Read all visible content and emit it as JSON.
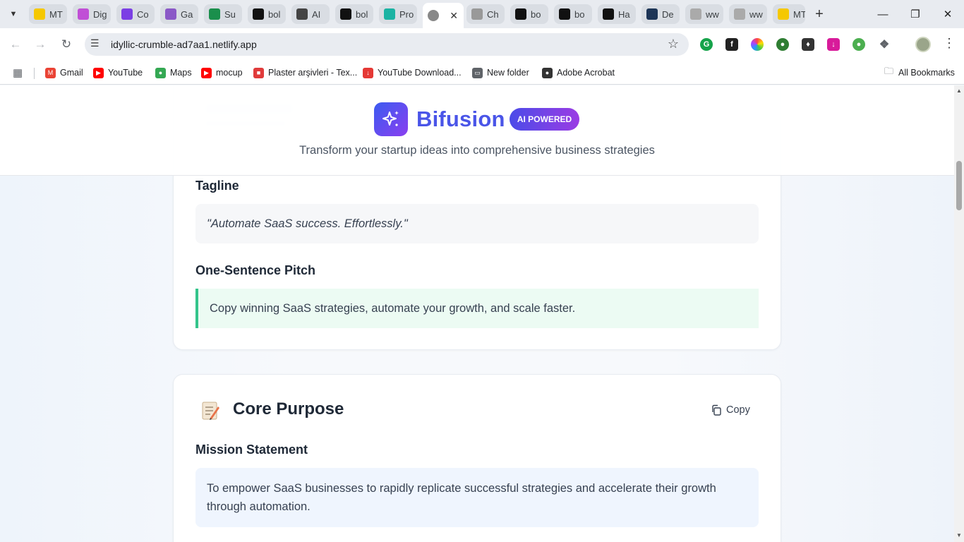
{
  "browser": {
    "tabs": [
      {
        "title": "MT",
        "favicon": "mtn-icon",
        "color": "#f5c800"
      },
      {
        "title": "Dig",
        "favicon": "grid-icon",
        "color": "#c04fd6"
      },
      {
        "title": "Co",
        "favicon": "arrow-icon",
        "color": "#7b3fe4"
      },
      {
        "title": "Ga",
        "favicon": "circle-icon",
        "color": "#8a58c7"
      },
      {
        "title": "Su",
        "favicon": "bolt-icon",
        "color": "#1a8f4c"
      },
      {
        "title": "bol",
        "favicon": "bolt-b-icon",
        "color": "#111111"
      },
      {
        "title": "AI",
        "favicon": "openai-icon",
        "color": "#444444"
      },
      {
        "title": "bol",
        "favicon": "bolt-b-icon",
        "color": "#111111"
      },
      {
        "title": "Pro",
        "favicon": "diamond-icon",
        "color": "#1bb3a3"
      },
      {
        "title": "",
        "favicon": "globe-icon",
        "color": "#888888",
        "active": true
      },
      {
        "title": "Ch",
        "favicon": "globe-icon",
        "color": "#999999"
      },
      {
        "title": "bo",
        "favicon": "bolt-b-icon",
        "color": "#111111"
      },
      {
        "title": "bo",
        "favicon": "bolt-b-icon",
        "color": "#111111"
      },
      {
        "title": "Ha",
        "favicon": "bolt-b-icon",
        "color": "#111111"
      },
      {
        "title": "De",
        "favicon": "d-icon",
        "color": "#1d3557"
      },
      {
        "title": "ww",
        "favicon": "globe-icon",
        "color": "#aaaaaa"
      },
      {
        "title": "ww",
        "favicon": "globe-icon",
        "color": "#aaaaaa"
      },
      {
        "title": "MT",
        "favicon": "mtn-icon",
        "color": "#f5c800"
      }
    ],
    "url": "idyllic-crumble-ad7aa1.netlify.app",
    "bookmarks": [
      {
        "label": "Gmail",
        "icon": "gmail-icon",
        "color": "#ea4335"
      },
      {
        "label": "YouTube",
        "icon": "youtube-icon",
        "color": "#ff0000"
      },
      {
        "label": "Maps",
        "icon": "maps-icon",
        "color": "#34a853"
      },
      {
        "label": "mocup",
        "icon": "youtube-icon",
        "color": "#ff0000"
      },
      {
        "label": "Plaster arşivleri - Tex...",
        "icon": "plaster-icon",
        "color": "#e03b3b"
      },
      {
        "label": "YouTube Download...",
        "icon": "download-icon",
        "color": "#e53935"
      },
      {
        "label": "New folder",
        "icon": "folder-icon",
        "color": "#5f6368"
      },
      {
        "label": "Adobe Acrobat",
        "icon": "acrobat-icon",
        "color": "#333333"
      }
    ],
    "all_bookmarks": "All Bookmarks"
  },
  "app": {
    "brand": "Bifusion",
    "badge": "AI POWERED",
    "subtitle": "Transform your startup ideas into comprehensive business strategies",
    "accent": "#4a55e8"
  },
  "branding_card": {
    "tagline_heading": "Tagline",
    "tagline": "\"Automate SaaS success. Effortlessly.\"",
    "pitch_heading": "One-Sentence Pitch",
    "pitch": "Copy winning SaaS strategies, automate your growth, and scale faster."
  },
  "core_purpose": {
    "title": "Core Purpose",
    "icon": "memo-icon",
    "copy_label": "Copy",
    "mission_heading": "Mission Statement",
    "mission": "To empower SaaS businesses to rapidly replicate successful strategies and accelerate their growth through automation."
  }
}
